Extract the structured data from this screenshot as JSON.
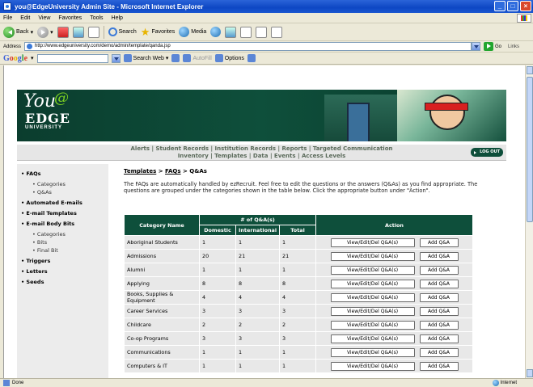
{
  "window": {
    "title": "you@EdgeUniversity Admin Site - Microsoft Internet Explorer"
  },
  "menu": [
    "File",
    "Edit",
    "View",
    "Favorites",
    "Tools",
    "Help"
  ],
  "toolbar": {
    "back": "Back",
    "search": "Search",
    "favorites": "Favorites",
    "media": "Media"
  },
  "address": {
    "label": "Address",
    "url": "http://www.edgeuniversity.com/demo/admin/template/qanda.jsp",
    "go": "Go",
    "links": "Links"
  },
  "google": {
    "search_web": "Search Web",
    "autofill": "AutoFill",
    "options": "Options"
  },
  "banner": {
    "logo_you": "You",
    "logo_at": "@",
    "logo_edge": "EDGE",
    "logo_university": "UNIVERSITY"
  },
  "topnav": {
    "line1": "Alerts | Student Records | Institution Records | Reports | Targeted Communication",
    "line2": "Inventory | Templates | Data | Events | Access Levels",
    "logout": "LOG OUT"
  },
  "sidebar": {
    "faqs": "• FAQs",
    "faqs_sub": [
      "• Categories",
      "• Q&As"
    ],
    "auto_emails": "• Automated E-mails",
    "email_templates": "• E-mail Templates",
    "email_body_bits": "• E-mail Body Bits",
    "body_bits_sub": [
      "• Categories",
      "• Bits",
      "• Final Bit"
    ],
    "triggers": "• Triggers",
    "letters": "• Letters",
    "seeds": "• Seeds"
  },
  "breadcrumb": {
    "templates": "Templates",
    "sep1": " > ",
    "faqs": "FAQs",
    "sep2": " > ",
    "current": "Q&As"
  },
  "intro": "The FAQs are automatically handled by ezRecruit. Feel free to edit the questions or the answers (Q&As) as you find appropriate. The questions are grouped under the categories shown in the table below. Click the appropriate button under \"Action\".",
  "table": {
    "headers": {
      "category": "Category Name",
      "count": "# of Q&A(s)",
      "domestic": "Domestic",
      "international": "International",
      "total": "Total",
      "action": "Action"
    },
    "view_label": "View/Edit/Del Q&A(s)",
    "add_label": "Add Q&A",
    "rows": [
      {
        "name": "Aboriginal Students",
        "domestic": "1",
        "international": "1",
        "total": "1"
      },
      {
        "name": "Admissions",
        "domestic": "20",
        "international": "21",
        "total": "21"
      },
      {
        "name": "Alumni",
        "domestic": "1",
        "international": "1",
        "total": "1"
      },
      {
        "name": "Applying",
        "domestic": "8",
        "international": "8",
        "total": "8"
      },
      {
        "name": "Books, Supplies & Equipment",
        "domestic": "4",
        "international": "4",
        "total": "4"
      },
      {
        "name": "Career Services",
        "domestic": "3",
        "international": "3",
        "total": "3"
      },
      {
        "name": "Childcare",
        "domestic": "2",
        "international": "2",
        "total": "2"
      },
      {
        "name": "Co-op Programs",
        "domestic": "3",
        "international": "3",
        "total": "3"
      },
      {
        "name": "Communications",
        "domestic": "1",
        "international": "1",
        "total": "1"
      },
      {
        "name": "Computers & IT",
        "domestic": "1",
        "international": "1",
        "total": "1"
      }
    ]
  },
  "status": {
    "left": "Done",
    "zone": "Internet"
  },
  "colors": {
    "brand_green": "#0e4f3b",
    "xp_blue": "#0d47c4"
  }
}
